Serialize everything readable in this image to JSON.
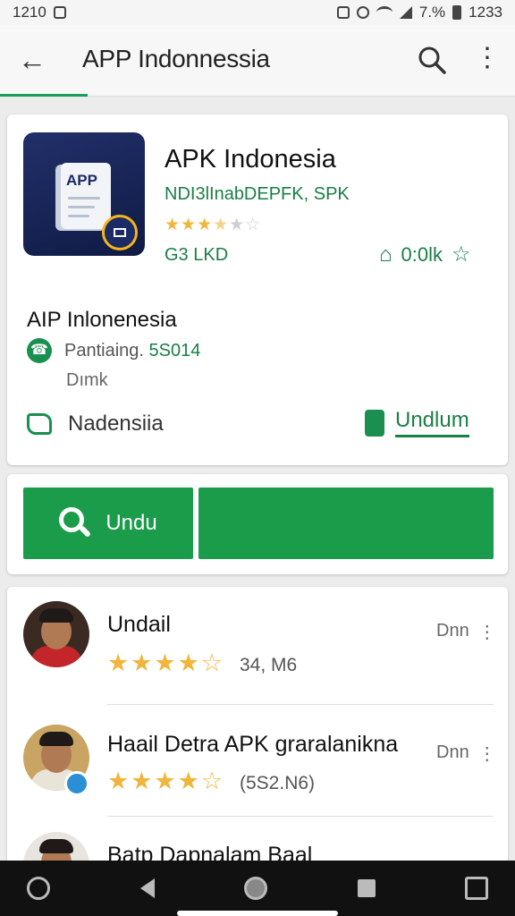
{
  "status_bar": {
    "time": "1210",
    "battery": "7.%",
    "clock": "1233"
  },
  "app_bar": {
    "title": "APP Indonnessia"
  },
  "app": {
    "icon_label": "APP",
    "name": "APK Indonesia",
    "developer": "NDI3lInabDEPFK, SPK",
    "rating": 3.5,
    "size": "G3 LKD",
    "wishlist": "0:0lk"
  },
  "details": {
    "title": "AIP Inlonenesia",
    "contact_label": "Pantiaing.",
    "contact_number": "5S014",
    "contact_sub": "Dımk",
    "location": "Nadensiia",
    "download_link": "Undlum"
  },
  "actions": {
    "install_label": "Undu"
  },
  "reviews": [
    {
      "name": "Undail",
      "stars": "★★★★",
      "half": "☆",
      "meta": "34, M6",
      "action": "Dnn",
      "more": "⋮"
    },
    {
      "name": "Haail Detra APK graralanikna",
      "stars": "★★★★",
      "half": "☆",
      "meta": "(5S2.N6)",
      "action": "Dnn",
      "more": "⋮"
    },
    {
      "name": "Batp Dapnalam Baal",
      "stars": "",
      "half": "",
      "meta": "",
      "action": "",
      "more": ""
    }
  ],
  "colors": {
    "accent": "#1a9c4b",
    "link": "#1a7f45",
    "star": "#f0b53a"
  }
}
